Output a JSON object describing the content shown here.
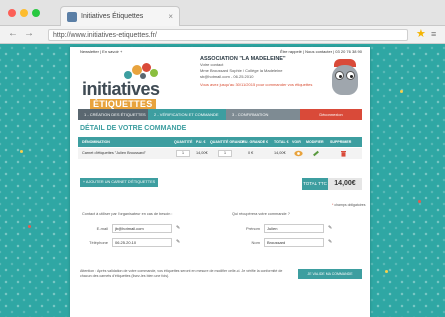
{
  "browser": {
    "tab_title": "Initiatives Étiquettes",
    "tab_close": "×",
    "url": "http://www.initiatives-etiquettes.fr/",
    "back_glyph": "←",
    "forward_glyph": "→",
    "star_glyph": "★",
    "menu_glyph": "≡"
  },
  "page": {
    "topbar_left": "Newsletter  |  En savoir +",
    "topbar_right": "Être rappelé  |  Nous contacter  |  03 20 76 38 90",
    "logo": {
      "line1": "initiatives",
      "line2": "ÉTIQUETTES"
    },
    "association": {
      "title": "ASSOCIATION \"LA MADELEINE\"",
      "line1": "Votre contact",
      "line2": "Mme Broussard Sophie / Collège la Madeleine",
      "line3": "sb@hotmail.com - 06.25.2010",
      "warning": "Vous avez jusqu'au 30/11/2015 pour commander vos étiquettes"
    },
    "steps": [
      "1 - CRÉATION DES ÉTIQUETTES",
      "2 - VÉRIFICATION ET COMMANDE",
      "3 - CONFIRMATION",
      "Déconnexion"
    ],
    "detail_title": "DÉTAIL DE VOTRE COMMANDE",
    "table": {
      "headers": [
        "DÉNOMINATION",
        "QUANTITÉ",
        "P.U. €",
        "QUANTITÉ GRANDE",
        "P.U. GRANDE €",
        "TOTAL €",
        "VOIR",
        "MODIFIER",
        "SUPPRIMER"
      ],
      "rows": [
        {
          "name": "Carnet d'étiquettes \"Julien Broussard\"",
          "qty": "1",
          "pu": "14,00€",
          "qty_grande": "1",
          "pu_grande": "0 €",
          "total": "14,00€"
        }
      ]
    },
    "add_button": "+ AJOUTER UN CARNET D'ÉTIQUETTES",
    "total_label": "TOTAL TTC",
    "total_value": "14,00€",
    "required_note": "champs obligatoires",
    "required_star": "*",
    "contact": {
      "label": "Contact à utiliser par l'organisateur en cas de besoin :",
      "email_label": "E-mail",
      "email_value": "jb@hotmail.com",
      "phone_label": "Téléphone",
      "phone_value": "06.25.20.10"
    },
    "retrait": {
      "label": "Qui récupérera votre commande ?",
      "prenom_label": "Prénom",
      "prenom_value": "Julien",
      "nom_label": "Nom",
      "nom_value": "Broussard"
    },
    "mention": "Attention : Après validation de votre commande, vos étiquettes seront en mesure de modifier celle-ci. Je vérifie la conformité de chacun des carnets d'étiquettes (lisez-les bien une fois).",
    "validate_button": "JE VALIDE MA COMMANDE D'ÉTIQUETTES",
    "edit_glyph": "✎"
  },
  "colors": {
    "teal": "#3d9ea0",
    "dark": "#5a6770",
    "red": "#d94a39",
    "orange": "#e8a33d",
    "background": "#2fa7a4"
  }
}
